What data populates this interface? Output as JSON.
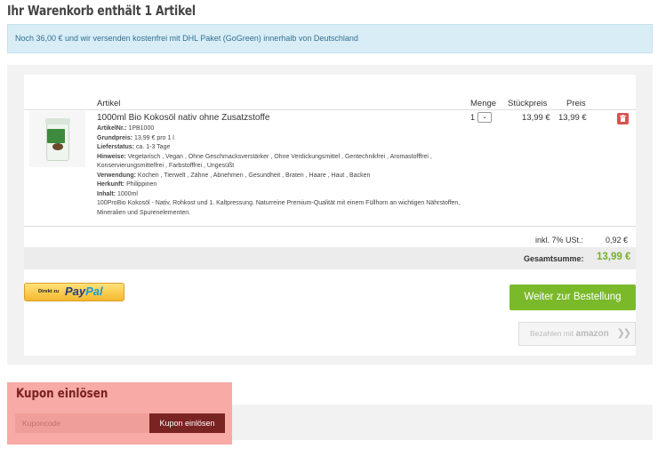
{
  "page": {
    "title": "Ihr Warenkorb enthält 1 Artikel"
  },
  "banner": {
    "text": "Noch 36,00 € und wir versenden kostenfrei mit DHL Paket (GoGreen) innerhalb von Deutschland"
  },
  "table": {
    "headers": {
      "article": "Artikel",
      "quantity": "Menge",
      "unit_price": "Stückpreis",
      "price": "Preis"
    }
  },
  "product": {
    "name": "1000ml Bio Kokosöl nativ ohne Zusatzstoffe",
    "article_no_label": "ArtikelNr.:",
    "article_no": "1PB1000",
    "base_price_label": "Grundpreis:",
    "base_price": "13,99 € pro 1 l",
    "delivery_label": "Lieferstatus:",
    "delivery": "ca. 1-3 Tage",
    "notes_label": "Hinweise:",
    "notes": "Vegetarisch , Vegan , Ohne Geschmacksverstärker , Ohne Verdickungsmittel , Gentechnikfrei , Aromastofffrei , Konservierungsmittelfrei , Farbstofffrei , Ungesüßt",
    "usage_label": "Verwendung:",
    "usage": "Kochen , Tierwelt , Zähne , Abnehmen , Gesundheit , Braten , Haare , Haut , Backen",
    "origin_label": "Herkunft:",
    "origin": "Philippinen",
    "content_label": "Inhalt:",
    "content": "1000ml",
    "description": "100ProBio Kokosöl - Nativ, Rohkost und 1. Kaltpressung. Naturreine Premium-Qualität mit einem Füllhorn an wichtigen Nährstoffen, Mineralien und Spurenelementen.",
    "quantity": "1",
    "unit_price": "13,99 €",
    "price": "13,99 €"
  },
  "summary": {
    "tax_label": "inkl. 7% USt.:",
    "tax_value": "0,92 €",
    "total_label": "Gesamtsumme:",
    "total_value": "13,99 €"
  },
  "buttons": {
    "paypal_small": "Direkt zu",
    "paypal_a": "Pay",
    "paypal_b": "Pal",
    "checkout": "Weiter zur Bestellung",
    "amazon_text": "Bezahlen mit",
    "amazon_logo": "amazon",
    "amazon_chevrons": "❯❯"
  },
  "coupon": {
    "title": "Kupon einlösen",
    "placeholder": "Kuponcode",
    "button": "Kupon einlösen"
  },
  "colors": {
    "accent_green": "#7ab929",
    "total_green": "#74b12e",
    "delete_red": "#d9534f",
    "coupon_dark": "#7a2323"
  },
  "icons": {
    "delete": "trash-icon",
    "quantity_dropdown": "chevron-down-icon"
  }
}
